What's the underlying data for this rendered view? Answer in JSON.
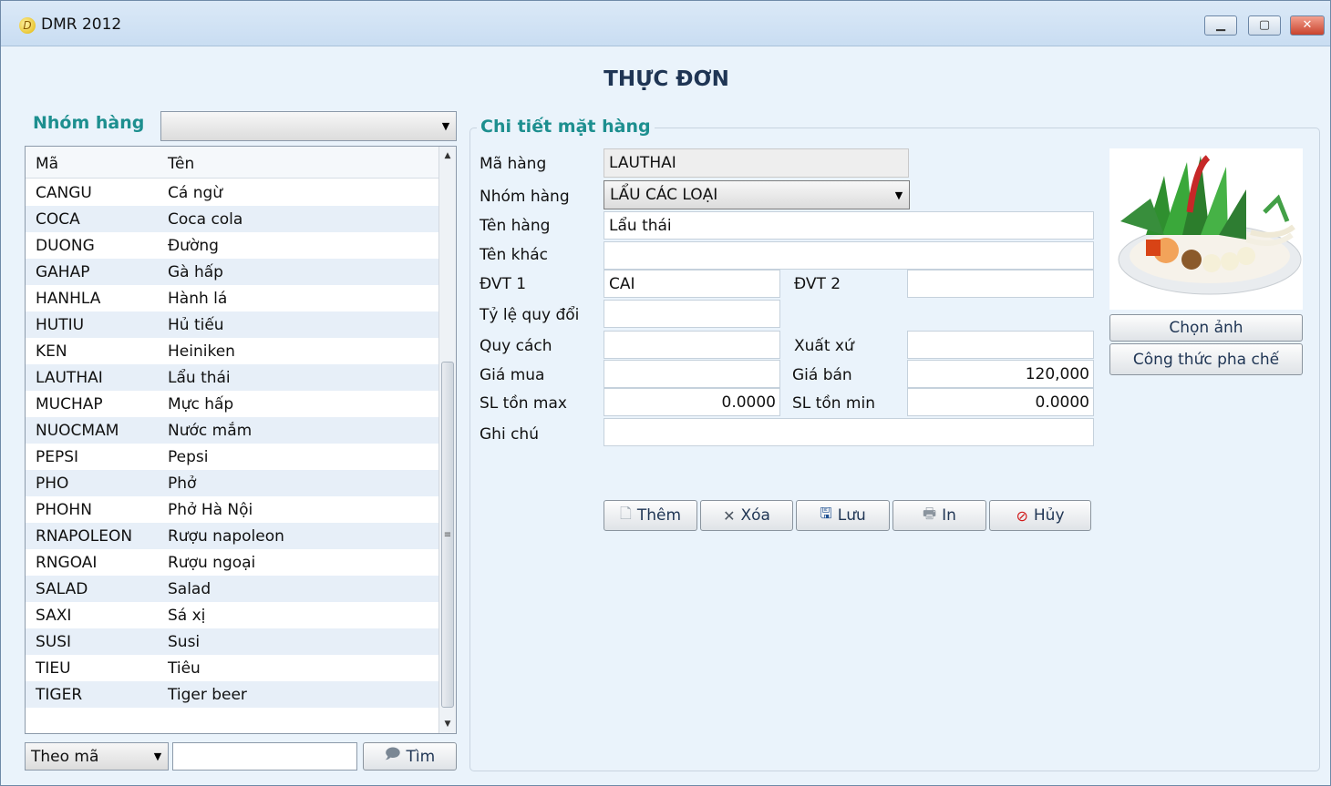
{
  "window": {
    "title": "DMR 2012",
    "controls": [
      "▁",
      "▢",
      "✕"
    ]
  },
  "form": {
    "title": "THỰC ĐƠN"
  },
  "left": {
    "group_label": "Nhóm hàng",
    "group_value": "",
    "columns": [
      "Mã",
      "Tên"
    ],
    "rows": [
      {
        "code": "CANGU",
        "name": "Cá ngừ"
      },
      {
        "code": "COCA",
        "name": "Coca cola"
      },
      {
        "code": "DUONG",
        "name": "Đường"
      },
      {
        "code": "GAHAP",
        "name": "Gà hấp"
      },
      {
        "code": "HANHLA",
        "name": "Hành lá"
      },
      {
        "code": "HUTIU",
        "name": "Hủ tiếu"
      },
      {
        "code": "KEN",
        "name": "Heiniken"
      },
      {
        "code": "LAUTHAI",
        "name": "Lẩu thái"
      },
      {
        "code": "MUCHAP",
        "name": "Mực hấp"
      },
      {
        "code": "NUOCMAM",
        "name": "Nước mắm"
      },
      {
        "code": "PEPSI",
        "name": "Pepsi"
      },
      {
        "code": "PHO",
        "name": "Phở"
      },
      {
        "code": "PHOHN",
        "name": "Phở Hà Nội"
      },
      {
        "code": "RNAPOLEON",
        "name": "Rượu napoleon"
      },
      {
        "code": "RNGOAI",
        "name": "Rượu ngoại"
      },
      {
        "code": "SALAD",
        "name": "Salad"
      },
      {
        "code": "SAXI",
        "name": "Sá xị"
      },
      {
        "code": "SUSI",
        "name": "Susi"
      },
      {
        "code": "TIEU",
        "name": "Tiêu"
      },
      {
        "code": "TIGER",
        "name": "Tiger beer"
      }
    ],
    "search_mode": "Theo mã",
    "search_value": "",
    "find_label": "Tìm"
  },
  "detail": {
    "title": "Chi tiết mặt hàng",
    "labels": {
      "code": "Mã hàng",
      "group": "Nhóm hàng",
      "name": "Tên hàng",
      "alt_name": "Tên khác",
      "unit1": "ĐVT 1",
      "unit2": "ĐVT 2",
      "ratio": "Tỷ lệ quy đổi",
      "spec": "Quy cách",
      "origin": "Xuất xứ",
      "buy_price": "Giá mua",
      "sell_price": "Giá bán",
      "stock_max": "SL tồn max",
      "stock_min": "SL tồn min",
      "note": "Ghi chú"
    },
    "values": {
      "code": "LAUTHAI",
      "group": "LẨU CÁC LOẠI",
      "name": "Lẩu thái",
      "alt_name": "",
      "unit1": "CAI",
      "unit2": "",
      "ratio": "",
      "spec": "",
      "origin": "",
      "buy_price": "",
      "sell_price": "120,000",
      "stock_max": "0.0000",
      "stock_min": "0.0000",
      "note": ""
    },
    "image_buttons": {
      "choose": "Chọn ảnh",
      "recipe": "Công thức pha chế"
    },
    "actions": {
      "add": "Thêm",
      "delete": "Xóa",
      "save": "Lưu",
      "print": "In",
      "cancel": "Hủy"
    }
  },
  "colors": {
    "section_title": "#1d8f8f",
    "title_text": "#1f3554",
    "row_alt": "#e7eff8",
    "cancel_icon": "#d11a1a"
  }
}
